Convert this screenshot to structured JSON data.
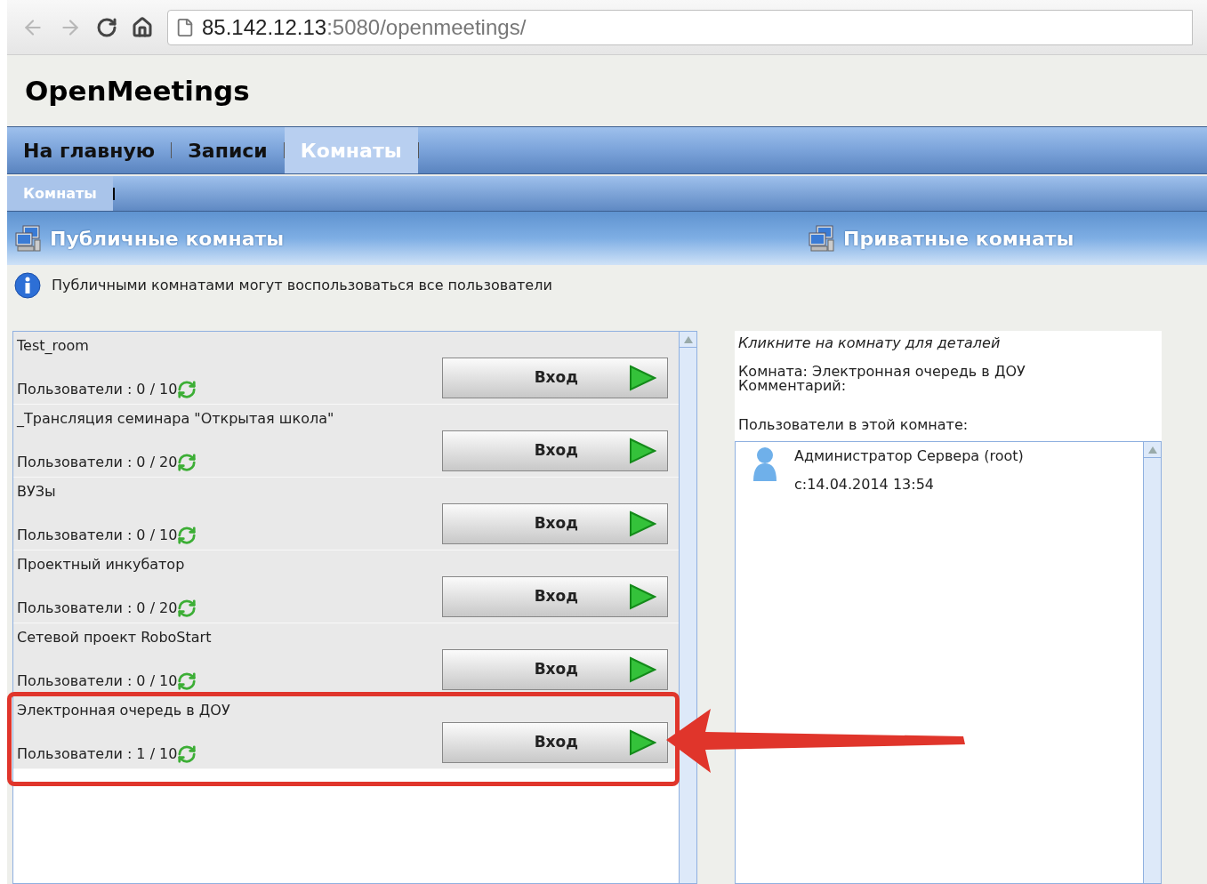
{
  "browser": {
    "url_host": "85.142.12.13",
    "url_path": ":5080/openmeetings/"
  },
  "app_title": "OpenMeetings",
  "nav": [
    {
      "label": "На главную",
      "selected": false
    },
    {
      "label": "Записи",
      "selected": false
    },
    {
      "label": "Комнаты",
      "selected": true
    }
  ],
  "subnav": [
    {
      "label": "Комнаты",
      "selected": true
    }
  ],
  "sections": [
    {
      "title": "Публичные комнаты"
    },
    {
      "title": "Приватные комнаты"
    }
  ],
  "info": "Публичными комнатами могут воспользоваться все пользователи",
  "rooms": [
    {
      "name": "Test_room",
      "users": "Пользователи : 0 / 10",
      "button": "Вход",
      "highlighted": false
    },
    {
      "name": "_Трансляция семинара \"Открытая школа\"",
      "users": "Пользователи : 0 / 20",
      "button": "Вход",
      "highlighted": false
    },
    {
      "name": "ВУЗы",
      "users": "Пользователи : 0 / 10",
      "button": "Вход",
      "highlighted": false
    },
    {
      "name": "Проектный инкубатор",
      "users": "Пользователи : 0 / 20",
      "button": "Вход",
      "highlighted": false
    },
    {
      "name": "Сетевой проект RoboStart",
      "users": "Пользователи : 0 / 10",
      "button": "Вход",
      "highlighted": false
    },
    {
      "name": "Электронная очередь в ДОУ",
      "users": "Пользователи : 1 / 10",
      "button": "Вход",
      "highlighted": true
    }
  ],
  "details": {
    "hint": "Кликните на комнату для деталей",
    "room": "Комната: Электронная очередь в ДОУ",
    "comment": "Комментарий:",
    "users_label": "Пользователи в этой комнате:",
    "users": [
      {
        "name": "Администратор Сервера (root)",
        "since": "с:14.04.2014 13:54"
      }
    ]
  }
}
